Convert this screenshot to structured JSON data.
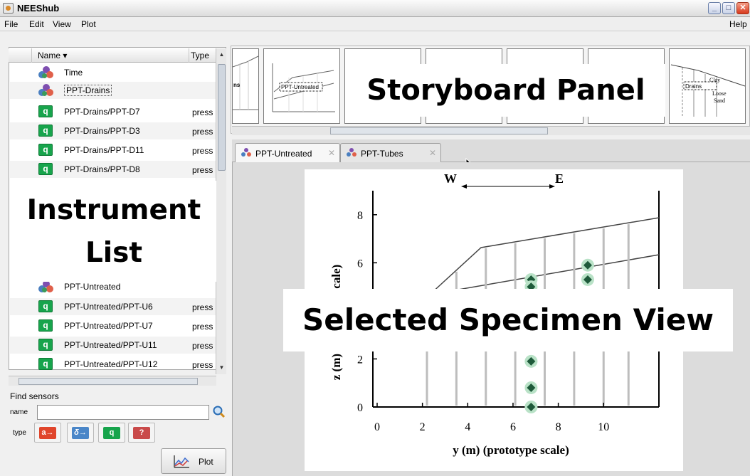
{
  "window": {
    "title": "NEEShub"
  },
  "menu": {
    "items": [
      "File",
      "Edit",
      "View",
      "Plot"
    ],
    "help": "Help"
  },
  "instrument_list": {
    "columns": {
      "name": "Name ▾",
      "type": "Type"
    },
    "rows": [
      {
        "name": "Time",
        "type": "",
        "icon": "group-dots-icon"
      },
      {
        "name": "PPT-Drains",
        "type": "",
        "icon": "group-dots-icon"
      },
      {
        "name": "PPT-Drains/PPT-D7",
        "type": "press",
        "icon": "q-icon"
      },
      {
        "name": "PPT-Drains/PPT-D3",
        "type": "press",
        "icon": "q-icon"
      },
      {
        "name": "PPT-Drains/PPT-D11",
        "type": "press",
        "icon": "q-icon"
      },
      {
        "name": "PPT-Drains/PPT-D8",
        "type": "press",
        "icon": "q-icon"
      },
      {
        "name": "PPT-Untreated",
        "type": "",
        "icon": "group-dots-icon"
      },
      {
        "name": "PPT-Untreated/PPT-U6",
        "type": "press",
        "icon": "q-icon"
      },
      {
        "name": "PPT-Untreated/PPT-U7",
        "type": "press",
        "icon": "q-icon"
      },
      {
        "name": "PPT-Untreated/PPT-U11",
        "type": "press",
        "icon": "q-icon"
      },
      {
        "name": "PPT-Untreated/PPT-U12",
        "type": "press",
        "icon": "q-icon"
      }
    ]
  },
  "overlays": {
    "instrument_line1": "Instrument",
    "instrument_line2": "List",
    "storyboard": "Storyboard Panel",
    "specimen": "Selected Specimen View"
  },
  "find_sensors": {
    "label": "Find sensors",
    "name_label": "name",
    "name_value": "",
    "type_label": "type",
    "type_buttons": [
      {
        "glyph": "a→",
        "color": "#e0452b"
      },
      {
        "glyph": "δ→",
        "color": "#4a86c8"
      },
      {
        "glyph": "q",
        "color": "#17a44c"
      },
      {
        "glyph": "?",
        "color": "#c94a4a"
      }
    ],
    "plot_button": "Plot"
  },
  "storyboard": {
    "thumb1_text": "ns",
    "thumb2_text": "PPT-Untreated",
    "last_thumb_text": {
      "a": "Clay",
      "b": "Drains",
      "c": "Loose",
      "d": "Sand"
    }
  },
  "tabs": [
    {
      "label": "PPT-Untreated",
      "active": true
    },
    {
      "label": "PPT-Tubes",
      "active": false
    }
  ],
  "plot": {
    "w_label": "W",
    "e_label": "E",
    "ylabel": "z (m) (prototype scale)",
    "xlabel": "y (m) (prototype scale)",
    "x_ticks": [
      "0",
      "2",
      "4",
      "6",
      "8",
      "10"
    ],
    "y_ticks": [
      "0",
      "2",
      "6",
      "8"
    ]
  },
  "chart_data": {
    "type": "scatter",
    "xlabel": "y (m) (prototype scale)",
    "ylabel": "z (m) (prototype scale)",
    "xlim": [
      0,
      12
    ],
    "ylim": [
      0,
      9
    ],
    "series": [
      {
        "name": "",
        "x": [
          6.8,
          6.8,
          6.8,
          6.8,
          6.8,
          9.3,
          9.3
        ],
        "y": [
          0,
          0.8,
          1.9,
          5.3,
          5.0,
          5.9,
          5.3
        ]
      }
    ]
  },
  "colors": {
    "q_green": "#17a44c",
    "marker_green": "#1e5a3a",
    "highlight": "#b9e2c7"
  }
}
